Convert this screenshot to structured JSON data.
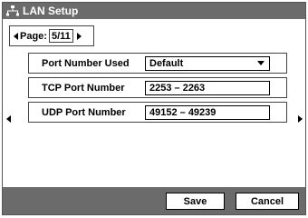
{
  "window": {
    "title": "LAN Setup",
    "icon": "network-icon"
  },
  "pager": {
    "label": "Page:",
    "value": "5/11"
  },
  "settings": [
    {
      "label": "Port Number Used",
      "value": "Default",
      "type": "select"
    },
    {
      "label": "TCP Port Number",
      "value": "2253 – 2263",
      "type": "text"
    },
    {
      "label": "UDP Port Number",
      "value": "49152 – 49239",
      "type": "text"
    }
  ],
  "footer": {
    "save_label": "Save",
    "cancel_label": "Cancel"
  }
}
